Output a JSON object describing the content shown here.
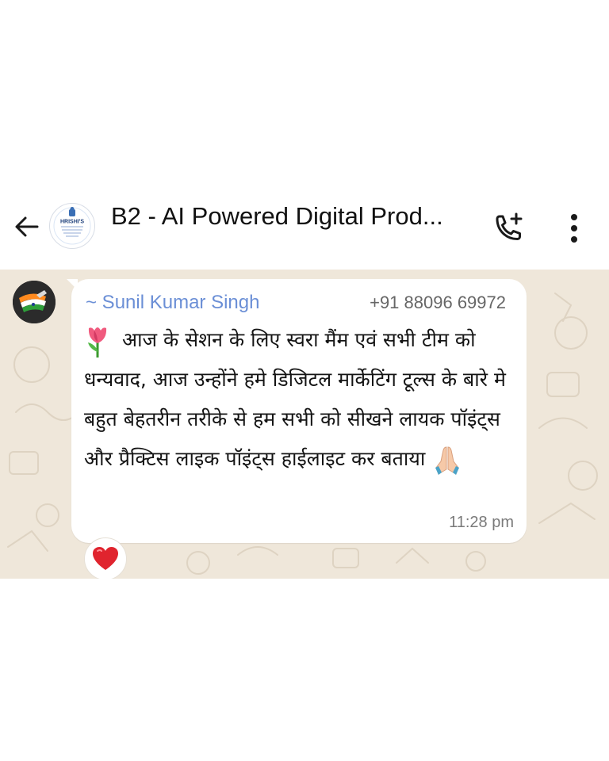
{
  "header": {
    "title": "B2 - AI Powered Digital Prod...",
    "back_icon": "arrow-left-icon",
    "call_icon": "add-call-icon",
    "menu_icon": "more-vertical-icon",
    "avatar": {
      "logo_text": "HRISHI'S",
      "logo_subtext": "AI PRODUCTIVITY · DIGITAL PRODUCT CERTIFIED COURSE"
    }
  },
  "message": {
    "sender_name": "~ Sunil Kumar Singh",
    "sender_phone": "+91 88096 69972",
    "leading_emoji": "tulip",
    "text": "आज के सेशन के लिए स्वरा मैंम एवं सभी टीम को धन्यवाद, आज उन्होंने हमे डिजिटल मार्केटिंग टूल्स के बारे मे बहुत बेहतरीन तरीके से हम सभी को सीखने लायक पॉइंट्स और प्रैक्टिस लाइक पॉइंट्स हाईलाइट कर बताया",
    "trailing_emoji": "folded-hands",
    "time": "11:28 pm",
    "reaction": "red-heart"
  },
  "colors": {
    "chat_background": "#efe7da",
    "bubble": "#ffffff",
    "sender_name": "#6b8fd6",
    "reaction_heart": "#e0242e"
  }
}
